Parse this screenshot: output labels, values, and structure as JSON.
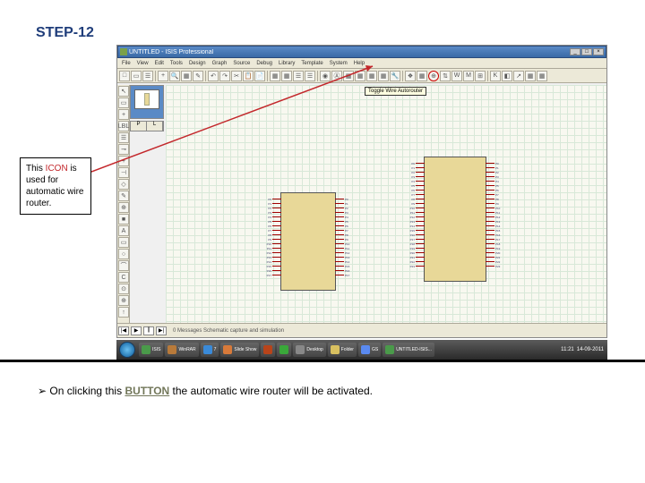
{
  "step": "STEP-12",
  "callout": {
    "pre": "This ",
    "icon": "ICON",
    "post": " is used for automatic wire router."
  },
  "footnote": {
    "arrow": "➢",
    "pre": " On clicking this ",
    "btn": "BUTTON",
    "post": " the automatic wire router will be activated."
  },
  "window": {
    "title": "UNTITLED - ISIS Professional",
    "min": "_",
    "max": "□",
    "close": "×"
  },
  "menu": [
    "File",
    "View",
    "Edit",
    "Tools",
    "Design",
    "Graph",
    "Source",
    "Debug",
    "Library",
    "Template",
    "System",
    "Help"
  ],
  "toolbar_main": [
    "□",
    "▭",
    "☰",
    "+",
    "🔍",
    "▦",
    "✎",
    "↶",
    "↷",
    "✂",
    "📋",
    "📄",
    "▦",
    "▦",
    "☰",
    "☰",
    "◉",
    "Ⓐ",
    "▦",
    "▦",
    "▦",
    "▦",
    "🔧",
    "❖",
    "▦",
    "⊕",
    "⇅",
    "W",
    "M",
    "⊞",
    "K",
    "◧",
    "↗",
    "▦",
    "▦"
  ],
  "tooltip": "Toggle Wire Autorouter",
  "auto_router_index": 25,
  "side_tools": [
    "↖",
    "▭",
    "+",
    "LBL",
    "☰",
    "⊸",
    "+",
    "⊣",
    "◇",
    "✎",
    "⊕",
    "■",
    "A",
    "▭",
    "○",
    "⌒",
    "C",
    "⊙",
    "⊕",
    "↑"
  ],
  "devsel": [
    "P",
    "L"
  ],
  "status_controls": [
    "|◀",
    "▶",
    "||",
    "▶|"
  ],
  "status_msg": "0 Messages        Schematic capture and simulation",
  "clock": "11:21",
  "date": "14-09-2011",
  "task_labels": [
    "ISIS",
    "WinRAR",
    "7",
    "Slide Show",
    "",
    "",
    "Desktop",
    "Folder",
    "GS",
    "UNTITLED-ISIS..."
  ],
  "colors": {
    "task_icons": [
      "#4a9a4a",
      "#b87a3a",
      "#3a8ad8",
      "#d87a3a",
      "#b8441a",
      "#3aa83a",
      "#888",
      "#d8c060",
      "#5a8af0",
      "#4a9a4a"
    ]
  }
}
